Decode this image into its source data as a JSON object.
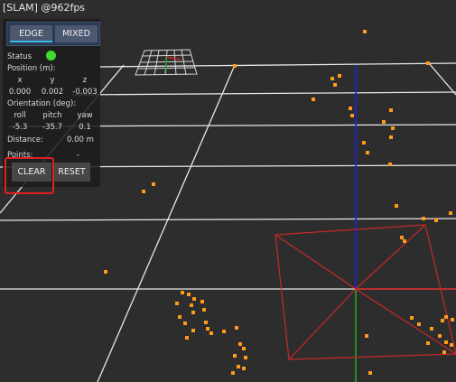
{
  "window": {
    "title": "[SLAM]  @962fps"
  },
  "panel": {
    "modes": {
      "edge": "EDGE",
      "mixed": "MIXED"
    },
    "status_label": "Status",
    "status_color": "#3ddc2f",
    "position_label": "Position (m):",
    "position_axes": [
      "x",
      "y",
      "z"
    ],
    "position_values": [
      "0.000",
      "0.002",
      "-0.003"
    ],
    "orientation_label": "Orientation (deg):",
    "orientation_axes": [
      "roll",
      "pitch",
      "yaw"
    ],
    "orientation_values": [
      "-5.3",
      "-35.7",
      "0.1"
    ],
    "distance_label": "Distance:",
    "distance_value": "0.00  m",
    "points_label": "Points:",
    "points_value": "-",
    "clear_label": "CLEAR",
    "reset_label": "RESET"
  },
  "colors": {
    "background": "#2d2d2d",
    "grid": "#e8e8e8",
    "feature_points": "#ff9a1a",
    "axis_x": "#c62828",
    "axis_y": "#1f9b1f",
    "axis_z": "#2222cc",
    "camera_frustum": "#c62828",
    "accent": "#35b8e8",
    "highlight_box": "#e02020"
  }
}
